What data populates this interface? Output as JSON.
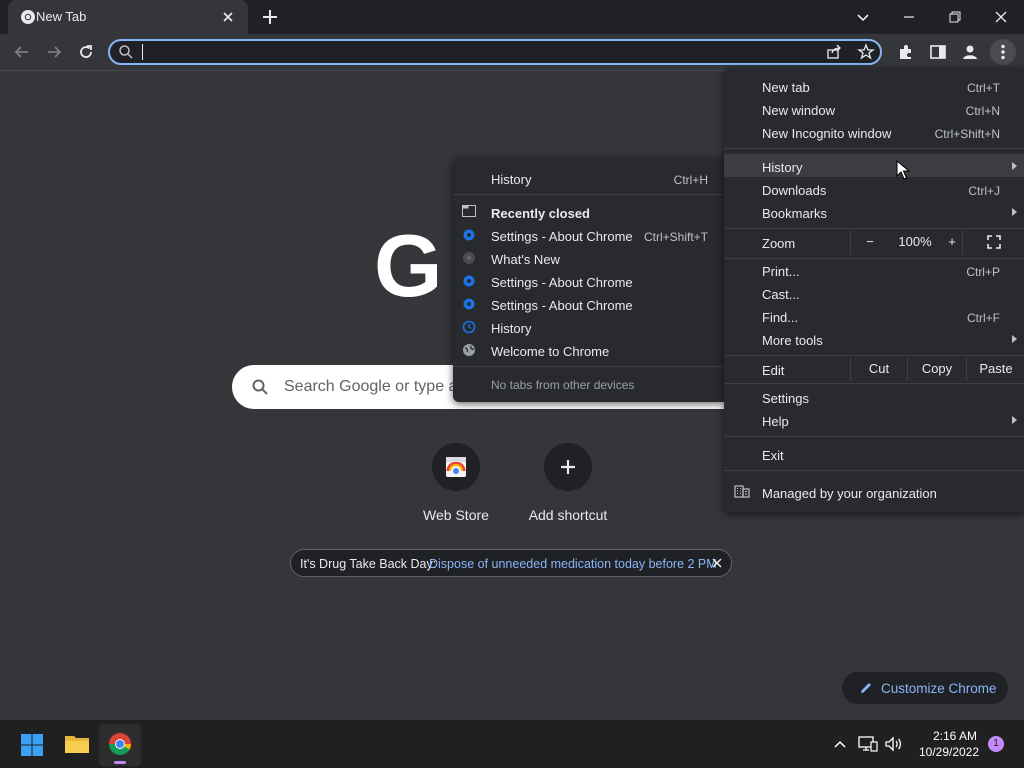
{
  "browser": {
    "tab_title": "New Tab",
    "omnibox_value": ""
  },
  "ntp": {
    "search_placeholder": "Search Google or type a",
    "shortcuts": [
      {
        "label": "Web Store"
      },
      {
        "label": "Add shortcut"
      }
    ],
    "promo_prefix": "It's Drug Take Back Day:",
    "promo_link": "Dispose of unneeded medication today before 2 PM",
    "customize_label": "Customize Chrome"
  },
  "main_menu": {
    "items": [
      {
        "label": "New tab",
        "shortcut": "Ctrl+T"
      },
      {
        "label": "New window",
        "shortcut": "Ctrl+N"
      },
      {
        "label": "New Incognito window",
        "shortcut": "Ctrl+Shift+N"
      },
      {
        "label": "History"
      },
      {
        "label": "Downloads",
        "shortcut": "Ctrl+J"
      },
      {
        "label": "Bookmarks"
      },
      {
        "label": "Zoom"
      },
      {
        "label": "Print...",
        "shortcut": "Ctrl+P"
      },
      {
        "label": "Cast..."
      },
      {
        "label": "Find...",
        "shortcut": "Ctrl+F"
      },
      {
        "label": "More tools"
      },
      {
        "label": "Edit"
      },
      {
        "label": "Settings"
      },
      {
        "label": "Help"
      },
      {
        "label": "Exit"
      },
      {
        "label": "Managed by your organization"
      }
    ],
    "zoom": {
      "minus": "−",
      "value": "100%",
      "plus": "+"
    },
    "edit": {
      "cut": "Cut",
      "copy": "Copy",
      "paste": "Paste"
    }
  },
  "history_menu": {
    "history_label": "History",
    "history_shortcut": "Ctrl+H",
    "recently_closed": "Recently closed",
    "items": [
      {
        "label": "Settings - About Chrome",
        "shortcut": "Ctrl+Shift+T",
        "icon": "gear-icon"
      },
      {
        "label": "What's New",
        "icon": "chrome-icon"
      },
      {
        "label": "Settings - About Chrome",
        "icon": "gear-icon"
      },
      {
        "label": "Settings - About Chrome",
        "icon": "gear-icon"
      },
      {
        "label": "History",
        "icon": "history-icon"
      },
      {
        "label": "Welcome to Chrome",
        "icon": "globe-icon"
      }
    ],
    "no_tabs": "No tabs from other devices"
  },
  "taskbar": {
    "time": "2:16 AM",
    "date": "10/29/2022",
    "notification_count": "1"
  },
  "colors": {
    "accent": "#8ab4f8",
    "gear_blue": "#1a73e8",
    "background": "#35363a",
    "menu": "#292a2d"
  }
}
